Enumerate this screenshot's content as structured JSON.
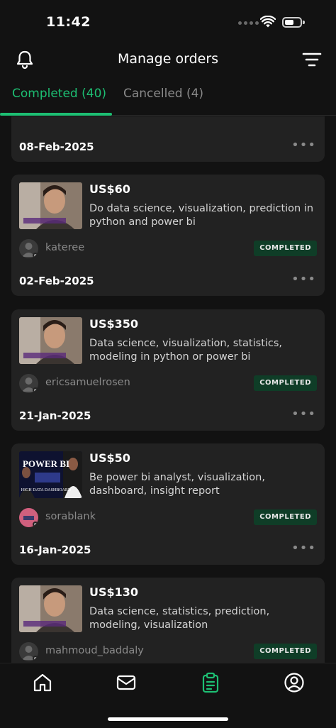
{
  "status": {
    "time": "11:42"
  },
  "header": {
    "title": "Manage orders"
  },
  "tabs": [
    {
      "label": "Completed (40)",
      "active": true
    },
    {
      "label": "Cancelled (4)",
      "active": false
    }
  ],
  "colors": {
    "accent": "#1dbf73",
    "card": "#222222",
    "background": "#121212",
    "badge": "#0f3d27"
  },
  "top_card": {
    "date": "08-Feb-2025"
  },
  "orders": [
    {
      "price": "US$60",
      "description": "Do data science, visualization, prediction in python and power bi",
      "seller": "kateree",
      "status": "COMPLETED",
      "date": "02-Feb-2025",
      "more": "•••"
    },
    {
      "price": "US$350",
      "description": "Data science, visualization, statistics, modeling in python or power bi",
      "seller": "ericsamuelrosen",
      "status": "COMPLETED",
      "date": "21-Jan-2025",
      "more": "•••"
    },
    {
      "price": "US$50",
      "description": "Be power bi analyst, visualization, dashboard, insight report",
      "seller": "sorablank",
      "status": "COMPLETED",
      "date": "16-Jan-2025",
      "more": "•••",
      "thumb_text": [
        "POWER BI",
        "HIGH DATA DASHBOARD"
      ]
    },
    {
      "price": "US$130",
      "description": "Data science, statistics, prediction, modeling, visualization",
      "seller": "mahmoud_baddaly",
      "status": "COMPLETED"
    }
  ],
  "bottom_nav": [
    "home-icon",
    "inbox-icon",
    "orders-icon",
    "profile-icon"
  ]
}
